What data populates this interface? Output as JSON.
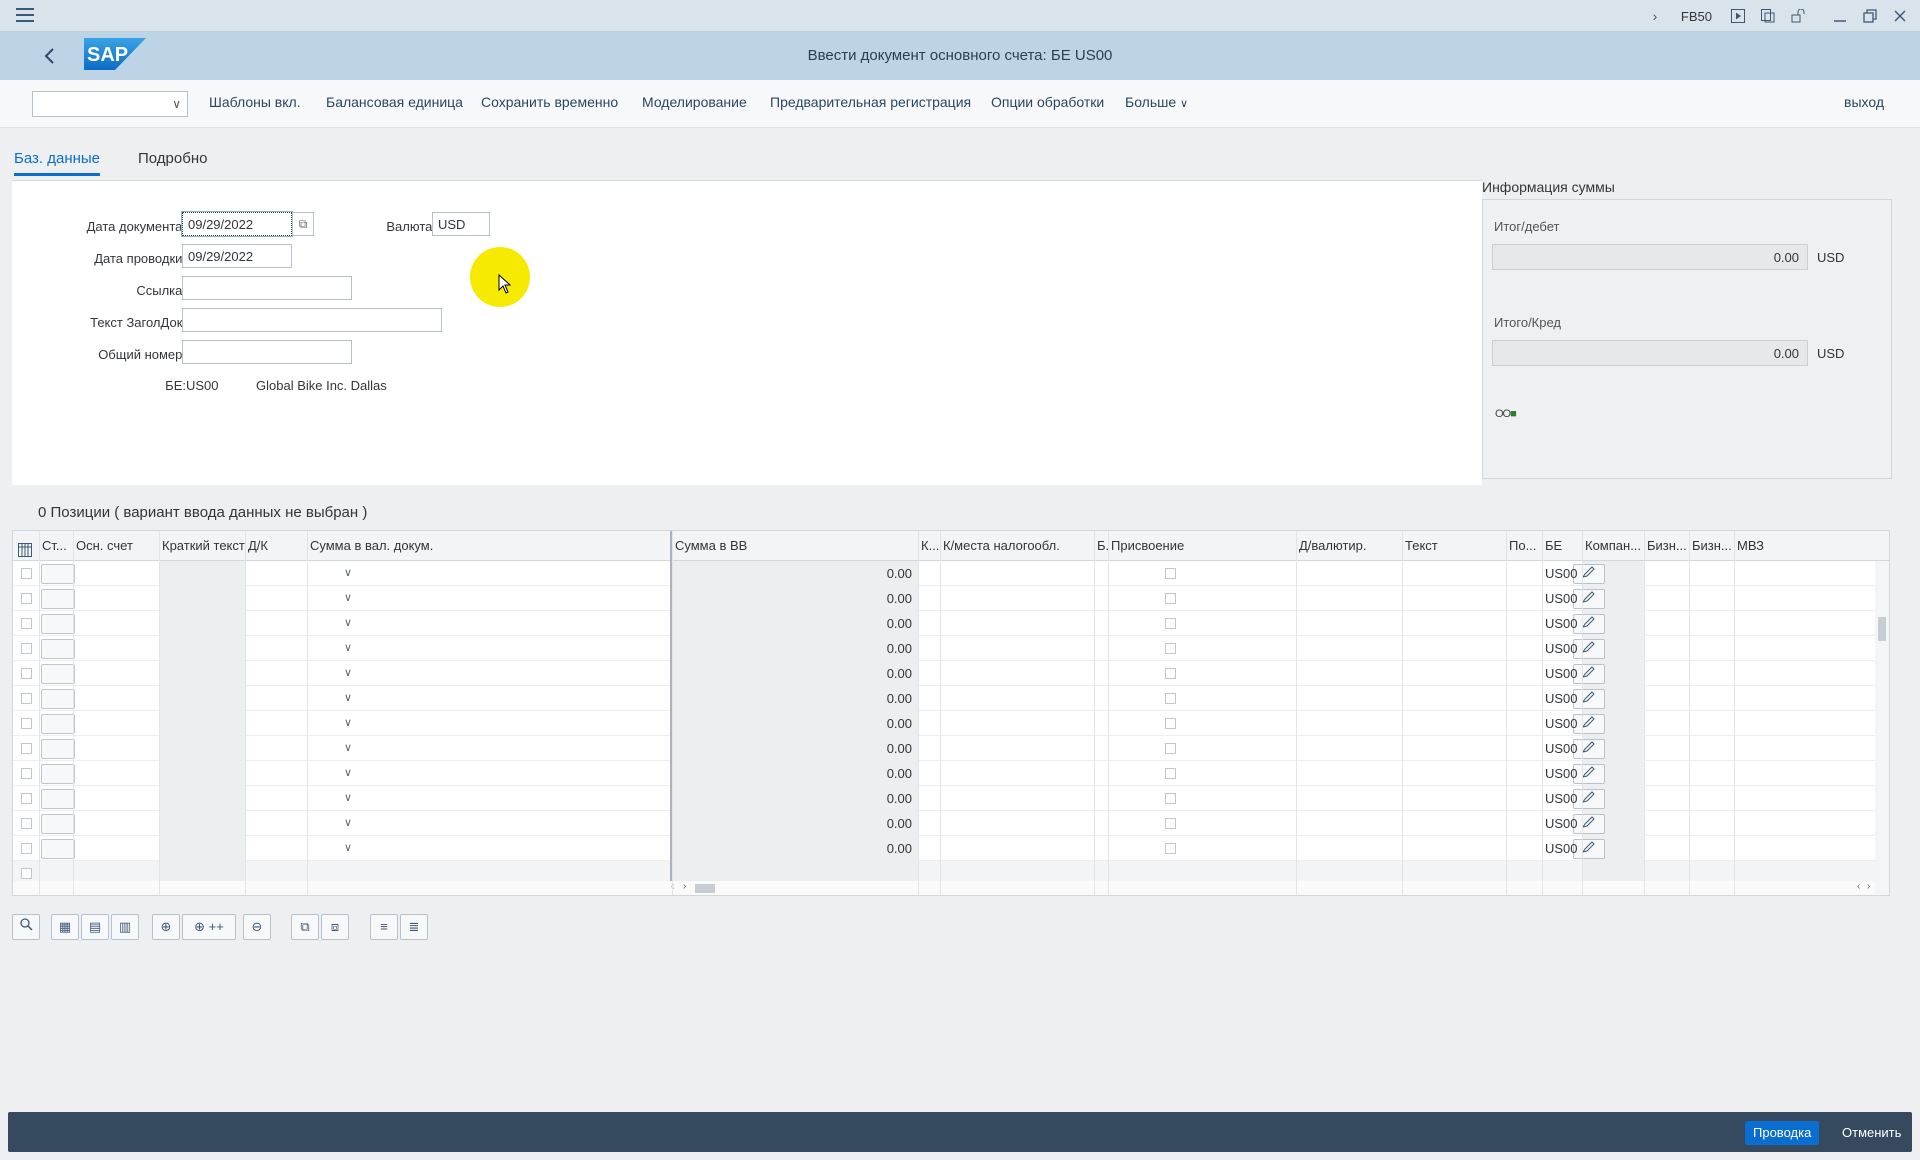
{
  "sysbar": {
    "tcode": "FB50"
  },
  "header": {
    "logo_text": "SAP",
    "title": "Ввести документ основного счета: БЕ US00"
  },
  "toolbar": {
    "buttons": [
      "Шаблоны вкл.",
      "Балансовая единица",
      "Сохранить временно",
      "Моделирование",
      "Предварительная регистрация",
      "Опции обработки",
      "Больше"
    ],
    "exit_label": "выход"
  },
  "tabs": [
    "Баз. данные",
    "Подробно"
  ],
  "form": {
    "doc_date_label": "Дата документа:",
    "doc_date": "09/29/2022",
    "currency_label": "Валюта:",
    "currency": "USD",
    "post_date_label": "Дата проводки:",
    "post_date": "09/29/2022",
    "reference_label": "Ссылка:",
    "header_text_label": "Текст ЗаголДок:",
    "general_number_label": "Общий номер:",
    "company_label": "БЕ:",
    "company_code": "US00",
    "company_name": "Global Bike Inc. Dallas"
  },
  "amount_info": {
    "title": "Информация суммы",
    "debit_label": "Итог/дебет",
    "debit_value": "0.00",
    "debit_currency": "USD",
    "credit_label": "Итого/Кред",
    "credit_value": "0.00",
    "credit_currency": "USD",
    "status_lights": "OO",
    "status_color": "#2b7d2b"
  },
  "items": {
    "title": "0 Позиции ( вариант ввода данных не выбран )",
    "columns": [
      "Ст...",
      "Осн. счет",
      "Краткий текст",
      "Д/К",
      "Сумма в вал. докум.",
      "Сумма в ВВ",
      "К...",
      "К/места налогообл.",
      "Б.",
      "Присвоение",
      "Д/валютир.",
      "Текст",
      "По...",
      "БЕ",
      "Компан...",
      "Бизн...",
      "Бизн...",
      "МВЗ"
    ],
    "rows": [
      {
        "amount_lc": "0.00",
        "company": "US00"
      },
      {
        "amount_lc": "0.00",
        "company": "US00"
      },
      {
        "amount_lc": "0.00",
        "company": "US00"
      },
      {
        "amount_lc": "0.00",
        "company": "US00"
      },
      {
        "amount_lc": "0.00",
        "company": "US00"
      },
      {
        "amount_lc": "0.00",
        "company": "US00"
      },
      {
        "amount_lc": "0.00",
        "company": "US00"
      },
      {
        "amount_lc": "0.00",
        "company": "US00"
      },
      {
        "amount_lc": "0.00",
        "company": "US00"
      },
      {
        "amount_lc": "0.00",
        "company": "US00"
      },
      {
        "amount_lc": "0.00",
        "company": "US00"
      },
      {
        "amount_lc": "0.00",
        "company": "US00"
      }
    ]
  },
  "grid_tools": {
    "insert_many_label": "++"
  },
  "footer": {
    "post_label": "Проводка",
    "cancel_label": "Отменить"
  },
  "colors": {
    "header_bg": "#bdd3e6",
    "accent": "#0a6ed1",
    "footer_bg": "#354a5f",
    "cursor_highlight": "#f5ea00"
  }
}
